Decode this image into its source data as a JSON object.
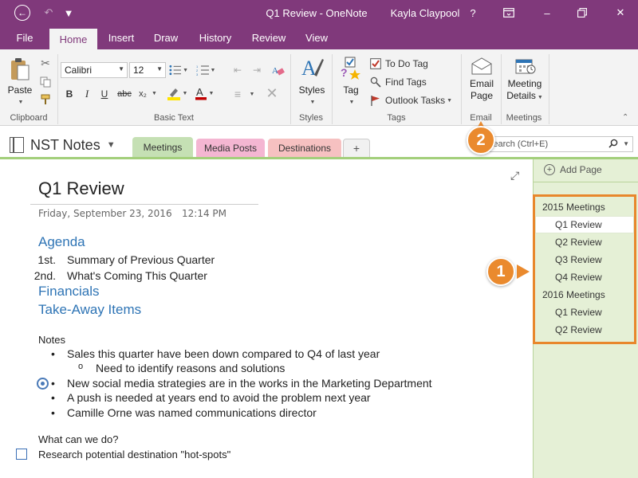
{
  "titlebar": {
    "title": "Q1 Review - OneNote",
    "user": "Kayla Claypool",
    "help": "?",
    "back_icon": "arrow-left-icon",
    "undo_icon": "undo-icon",
    "minimize": "–",
    "close": "✕",
    "accent": "#80397b"
  },
  "tabs": [
    "File",
    "Home",
    "Insert",
    "Draw",
    "History",
    "Review",
    "View"
  ],
  "ribbon": {
    "clipboard": {
      "label": "Clipboard",
      "paste": "Paste"
    },
    "basic_text": {
      "label": "Basic Text",
      "font": "Calibri",
      "size": "12",
      "bold": "B",
      "italic": "I",
      "underline": "U",
      "strike": "abc",
      "subscript": "x₂"
    },
    "styles": {
      "label": "Styles",
      "button": "Styles"
    },
    "tags": {
      "label": "Tags",
      "tag": "Tag",
      "todo": "To Do Tag",
      "find": "Find Tags",
      "outlook": "Outlook Tasks"
    },
    "email": {
      "label": "Email",
      "button_line1": "Email",
      "button_line2": "Page"
    },
    "meetings": {
      "label": "Meetings",
      "button_line1": "Meeting",
      "button_line2": "Details"
    }
  },
  "notebook": {
    "name": "NST Notes",
    "sections": [
      {
        "label": "Meetings",
        "color": "#c5e0b4"
      },
      {
        "label": "Media Posts",
        "color": "#f4b6d2"
      },
      {
        "label": "Destinations",
        "color": "#f6c1c1"
      }
    ],
    "add_section": "+",
    "search_placeholder": "Search (Ctrl+E)"
  },
  "page": {
    "title": "Q1 Review",
    "date": "Friday, September 23, 2016",
    "time": "12:14 PM",
    "agenda_heading": "Agenda",
    "agenda": [
      {
        "num": "1st.",
        "text": "Summary of Previous Quarter"
      },
      {
        "num": "2nd.",
        "text": "What's Coming This Quarter"
      }
    ],
    "financials_heading": "Financials",
    "takeaway_heading": "Take-Away Items",
    "notes_label": "Notes",
    "notes": [
      "Sales this quarter have been down compared to Q4 of last year",
      "Need to identify reasons and solutions",
      "New social media strategies are in the works in the Marketing Department",
      "A push is needed at years end to avoid the problem next year",
      "Camille Orne was named communications director"
    ],
    "question": "What can we do?",
    "todo_item": "Research potential destination \"hot-spots\""
  },
  "pagelist": {
    "add_page": "Add Page",
    "items": [
      {
        "label": "2015 Meetings",
        "type": "group"
      },
      {
        "label": "Q1 Review",
        "type": "page",
        "selected": true
      },
      {
        "label": "Q2 Review",
        "type": "page"
      },
      {
        "label": "Q3 Review",
        "type": "page"
      },
      {
        "label": "Q4 Review",
        "type": "page"
      },
      {
        "label": "2016 Meetings",
        "type": "group"
      },
      {
        "label": "Q1 Review",
        "type": "page"
      },
      {
        "label": "Q2 Review",
        "type": "page"
      }
    ]
  },
  "callouts": {
    "one": "1",
    "two": "2",
    "color": "#ea8a2e"
  }
}
